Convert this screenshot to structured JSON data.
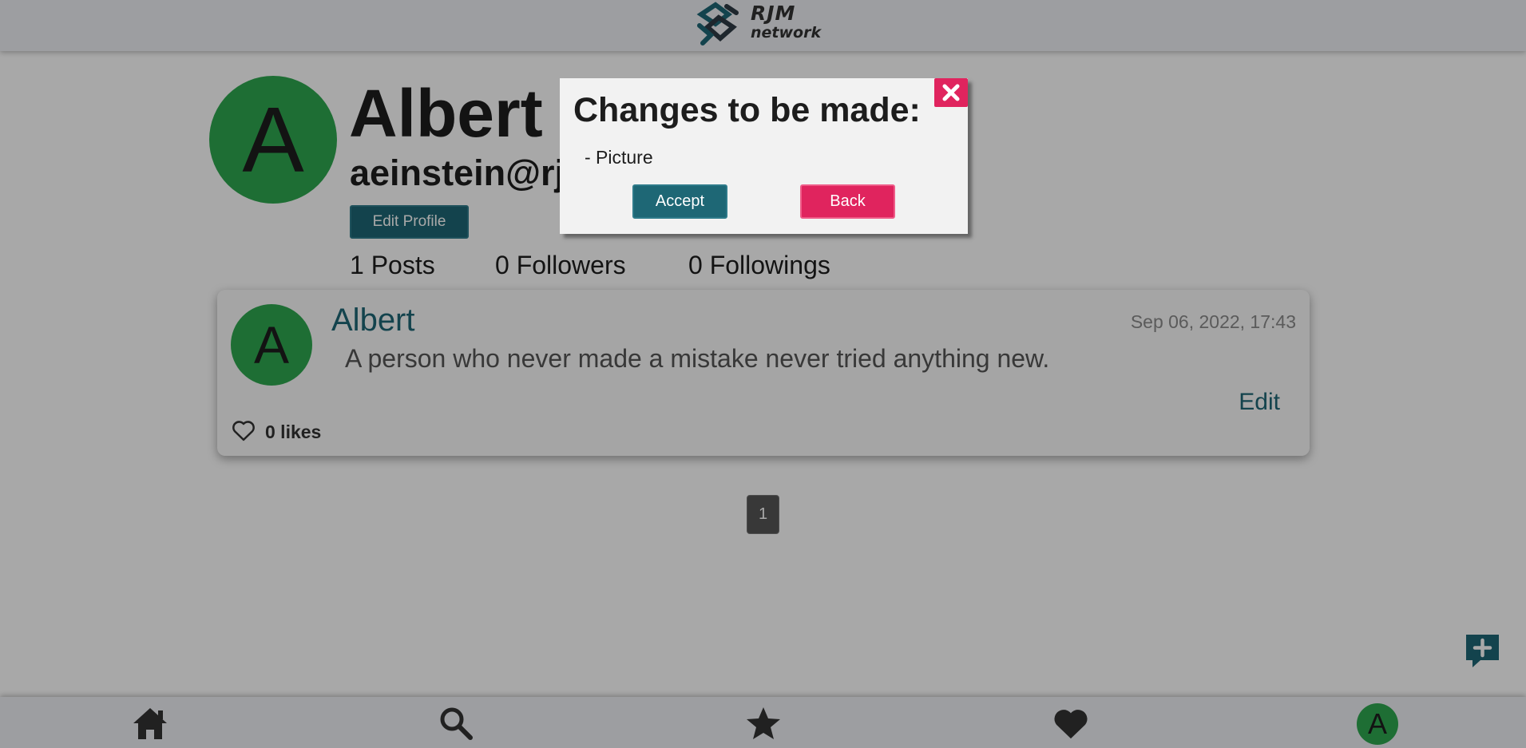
{
  "app": {
    "logo_line1": "RJM",
    "logo_line2": "network",
    "brand_color": "#1e6775",
    "accent_color": "#e0245e",
    "avatar_color": "#2ea84f"
  },
  "profile": {
    "initial": "A",
    "name": "Albert",
    "email": "aeinstein@rjm",
    "edit_label": "Edit Profile",
    "stats": {
      "posts": "1 Posts",
      "followers": "0 Followers",
      "followings": "0 Followings"
    }
  },
  "post": {
    "initial": "A",
    "author": "Albert",
    "date": "Sep 06, 2022, 17:43",
    "text": "A person who never made a mistake never tried anything new.",
    "edit_label": "Edit",
    "likes_label": "0 likes",
    "like_icon": "heart-outline-icon"
  },
  "pagination": {
    "current": "1"
  },
  "fab": {
    "icon": "new-post-icon"
  },
  "bottom_nav": {
    "items": [
      {
        "name": "home",
        "icon": "home-icon"
      },
      {
        "name": "search",
        "icon": "search-icon"
      },
      {
        "name": "favorites",
        "icon": "star-icon"
      },
      {
        "name": "likes",
        "icon": "heart-icon"
      }
    ],
    "avatar_initial": "A"
  },
  "modal": {
    "title": "Changes to be made:",
    "items": [
      "- Picture"
    ],
    "accept_label": "Accept",
    "back_label": "Back",
    "close_icon": "close-icon"
  }
}
